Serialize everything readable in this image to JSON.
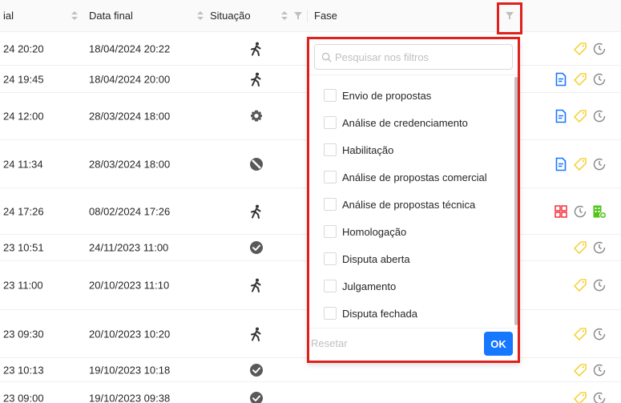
{
  "header": {
    "col_inicial": "ial",
    "col_final": "Data final",
    "col_situacao": "Situação",
    "col_fase": "Fase"
  },
  "rows": [
    {
      "inicial": "24 20:20",
      "final": "18/04/2024 20:22",
      "situacao": "running",
      "actions": [
        "tag-icon",
        "clock-icon"
      ]
    },
    {
      "inicial": "24 19:45",
      "final": "18/04/2024 20:00",
      "situacao": "running",
      "actions": [
        "document-icon",
        "tag-icon",
        "clock-icon"
      ]
    },
    {
      "inicial": "24 12:00",
      "final": "28/03/2024 18:00",
      "situacao": "processing",
      "actions": [
        "document-icon",
        "tag-icon",
        "clock-icon"
      ]
    },
    {
      "inicial": "24 11:34",
      "final": "28/03/2024 18:00",
      "situacao": "blocked",
      "actions": [
        "document-icon",
        "tag-icon",
        "clock-icon"
      ]
    },
    {
      "inicial": "24 17:26",
      "final": "08/02/2024 17:26",
      "situacao": "running",
      "actions": [
        "grid-icon",
        "clock-icon",
        "building-add-icon"
      ]
    },
    {
      "inicial": "23 10:51",
      "final": "24/11/2023 11:00",
      "situacao": "done",
      "actions": [
        "tag-icon",
        "clock-icon"
      ]
    },
    {
      "inicial": "23 11:00",
      "final": "20/10/2023 11:10",
      "situacao": "running",
      "actions": [
        "tag-icon",
        "clock-icon"
      ]
    },
    {
      "inicial": "23 09:30",
      "final": "20/10/2023 10:20",
      "situacao": "running",
      "actions": [
        "tag-icon",
        "clock-icon"
      ]
    },
    {
      "inicial": "23 10:13",
      "final": "19/10/2023 10:18",
      "situacao": "done",
      "actions": [
        "tag-icon",
        "clock-icon"
      ]
    },
    {
      "inicial": "23 09:00",
      "final": "19/10/2023 09:38",
      "situacao": "done",
      "actions": [
        "tag-icon",
        "clock-icon"
      ]
    }
  ],
  "filter_dropdown": {
    "search_placeholder": "Pesquisar nos filtros",
    "options": [
      {
        "label": "Envio de propostas",
        "checked": false
      },
      {
        "label": "Análise de credenciamento",
        "checked": false
      },
      {
        "label": "Habilitação",
        "checked": false
      },
      {
        "label": "Análise de propostas comercial",
        "checked": false
      },
      {
        "label": "Análise de propostas técnica",
        "checked": false
      },
      {
        "label": "Homologação",
        "checked": false
      },
      {
        "label": "Disputa aberta",
        "checked": false
      },
      {
        "label": "Julgamento",
        "checked": false
      },
      {
        "label": "Disputa fechada",
        "checked": false
      }
    ],
    "reset_label": "Resetar",
    "ok_label": "OK"
  },
  "colors": {
    "highlight": "#e0201b",
    "primary": "#1677ff",
    "tag": "#f5d442",
    "document": "#1677ff",
    "grid": "#f5222d",
    "building": "#52c41a",
    "status": "#595959"
  }
}
